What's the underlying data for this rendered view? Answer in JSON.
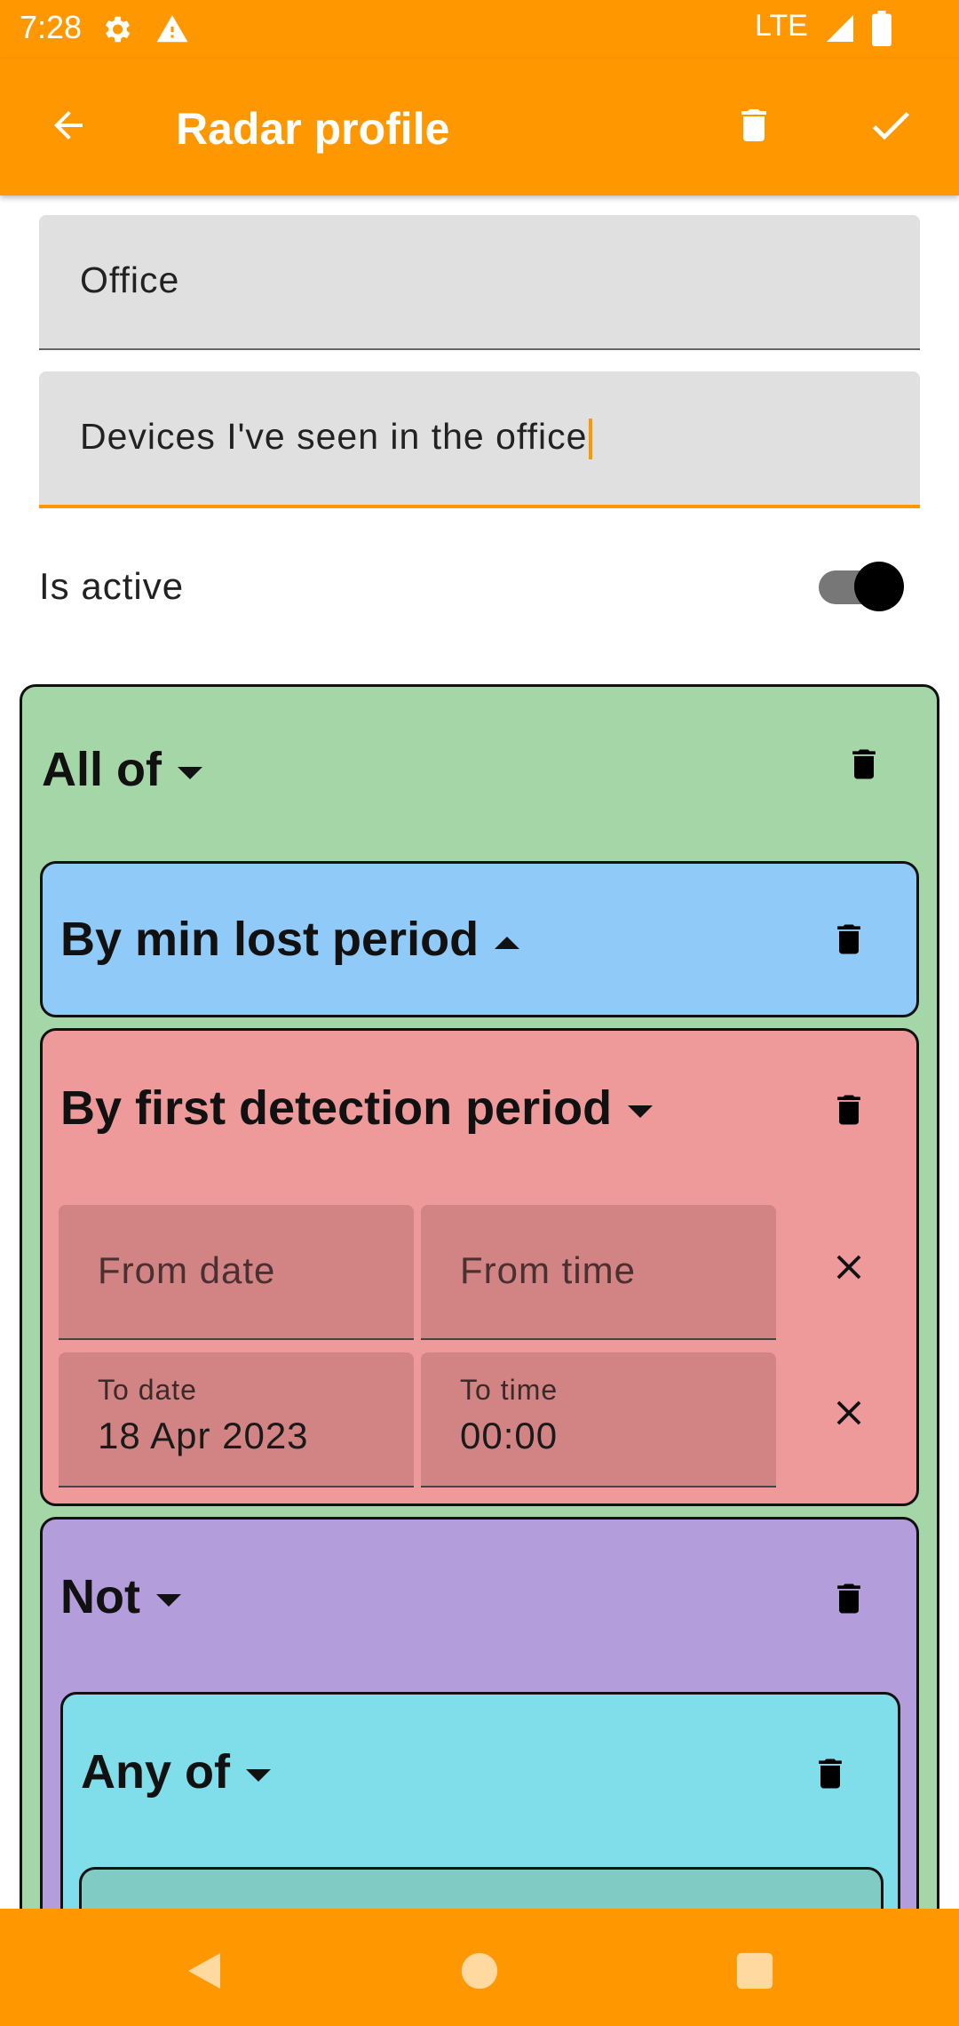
{
  "status_bar": {
    "time": "7:28",
    "network": "LTE",
    "icons": [
      "settings-icon",
      "warning-icon",
      "signal-icon",
      "battery-icon"
    ]
  },
  "app_bar": {
    "title": "Radar profile",
    "back_icon": "arrow-back-icon",
    "delete_icon": "trash-icon",
    "confirm_icon": "check-icon"
  },
  "form": {
    "name_value": "Office",
    "description_value": "Devices I've seen in the office",
    "is_active_label": "Is active",
    "is_active": true
  },
  "filters": {
    "root": {
      "label": "All of",
      "color": "#a5d6a7"
    },
    "min_lost": {
      "label": "By min lost period",
      "color": "#90caf9"
    },
    "first_detection": {
      "label": "By first detection period",
      "color": "#ef9a9a",
      "from_date_placeholder": "From date",
      "from_time_placeholder": "From time",
      "to_date_label": "To date",
      "to_date_value": "18 Apr 2023",
      "to_time_label": "To time",
      "to_time_value": "00:00"
    },
    "not": {
      "label": "Not",
      "color": "#b39ddb"
    },
    "any_of": {
      "label": "Any of",
      "color": "#80deea"
    },
    "inner_color": "#80cbc4"
  },
  "nav_bar": {
    "icons": [
      "back-triangle-icon",
      "home-circle-icon",
      "recents-square-icon"
    ]
  },
  "colors": {
    "accent": "#ff9800"
  }
}
